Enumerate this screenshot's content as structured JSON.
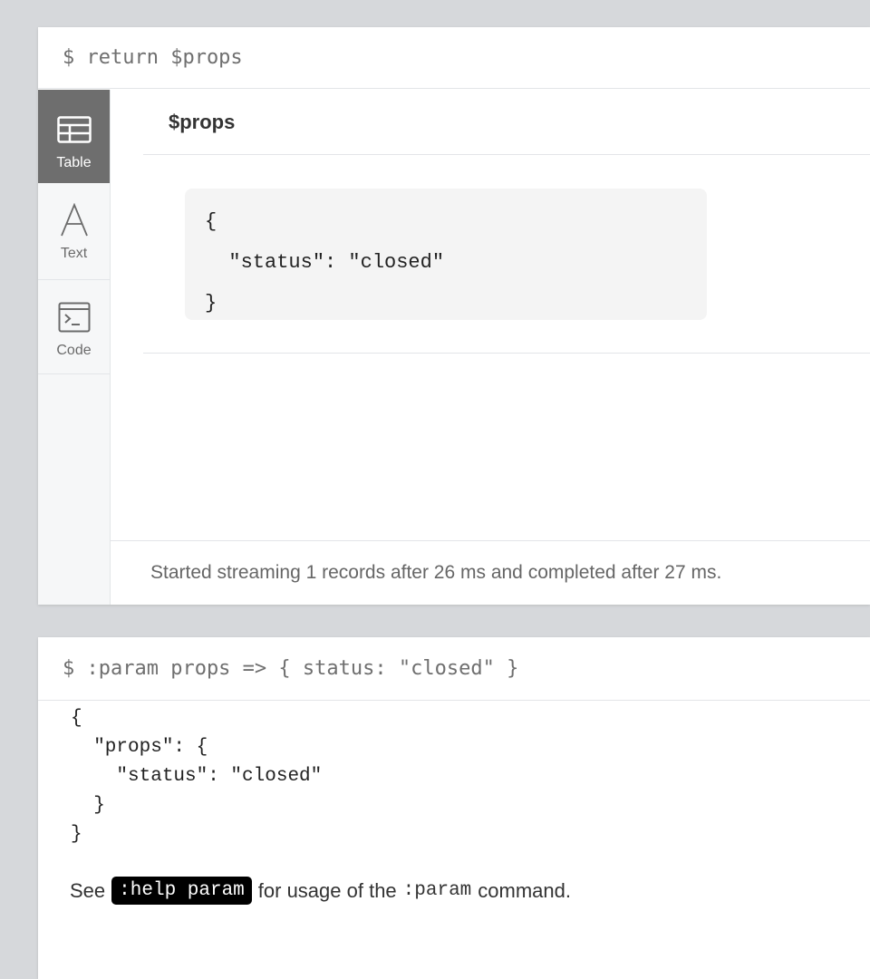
{
  "frame1": {
    "command": "$ return $props",
    "sidebar": {
      "items": [
        {
          "label": "Table",
          "icon": "table-icon",
          "active": true
        },
        {
          "label": "Text",
          "icon": "text-icon",
          "active": false
        },
        {
          "label": "Code",
          "icon": "code-icon",
          "active": false
        }
      ]
    },
    "column_header": "$props",
    "cell_json": {
      "open": "{",
      "line": "  \"status\": \"closed\"",
      "close": "}"
    },
    "status_message": "Started streaming 1 records after 26 ms and completed after 27 ms."
  },
  "frame2": {
    "command": "$ :param props => { status: \"closed\" }",
    "json_output": "{\n  \"props\": {\n    \"status\": \"closed\"\n  }\n}",
    "help": {
      "prefix": "See",
      "link_label": ":help param",
      "middle": "for usage of the",
      "inline_code": ":param",
      "suffix": "command."
    }
  },
  "colors": {
    "background": "#d6d8db",
    "active_tab": "#6e6e6e",
    "code_box": "#f4f4f4"
  }
}
